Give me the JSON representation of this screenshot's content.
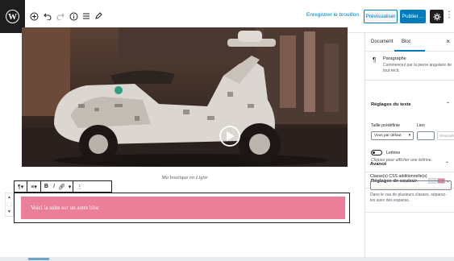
{
  "toolbar": {
    "logo_letter": "W",
    "save_draft": "Enregistrer le brouillon",
    "preview": "Prévisualiser",
    "publish": "Publier…",
    "icons": [
      "plus-icon",
      "undo-icon",
      "redo-icon",
      "info-icon",
      "list-icon",
      "pencil-icon",
      "gear-icon",
      "more-icon"
    ]
  },
  "editor": {
    "caption": "Ma boutique en Ligne",
    "highlighted_block_text": "Voici la suite sur un autre bloc",
    "block_color": "#eb7e99",
    "block_toolbar": [
      "paragraph-icon",
      "align-icon",
      "bold-icon",
      "italic-icon",
      "link-icon",
      "more-formatting-icon",
      "more-options-icon"
    ]
  },
  "sidebar": {
    "tabs": [
      {
        "label": "Document"
      },
      {
        "label": "Bloc"
      }
    ],
    "close": "×",
    "block_card": {
      "title": "Paragraphe",
      "description": "Commencez par la pierre angulaire de tout récit."
    },
    "text_settings": {
      "title": "Réglages du texte",
      "preset_label": "Taille prédéfinie",
      "preset_value": "Vous par défaut",
      "custom_label": "Lien",
      "reset_label": "Réinitialiser",
      "dropcap_label": "Lettrine",
      "dropcap_help": "Cliquez pour afficher une lettrine."
    },
    "color_settings": {
      "title": "Réglages de couleur",
      "swatches": [
        "#e2e4e7",
        "#eb7e99"
      ]
    },
    "advanced": {
      "title": "Avancé",
      "css_label": "Classe(s) CSS additionnelle(s)",
      "help": "Dans le cas de plusieurs classes, séparez-les avec des espaces."
    }
  },
  "colors": {
    "accent": "#007cba",
    "dark": "#1e1e1e"
  }
}
